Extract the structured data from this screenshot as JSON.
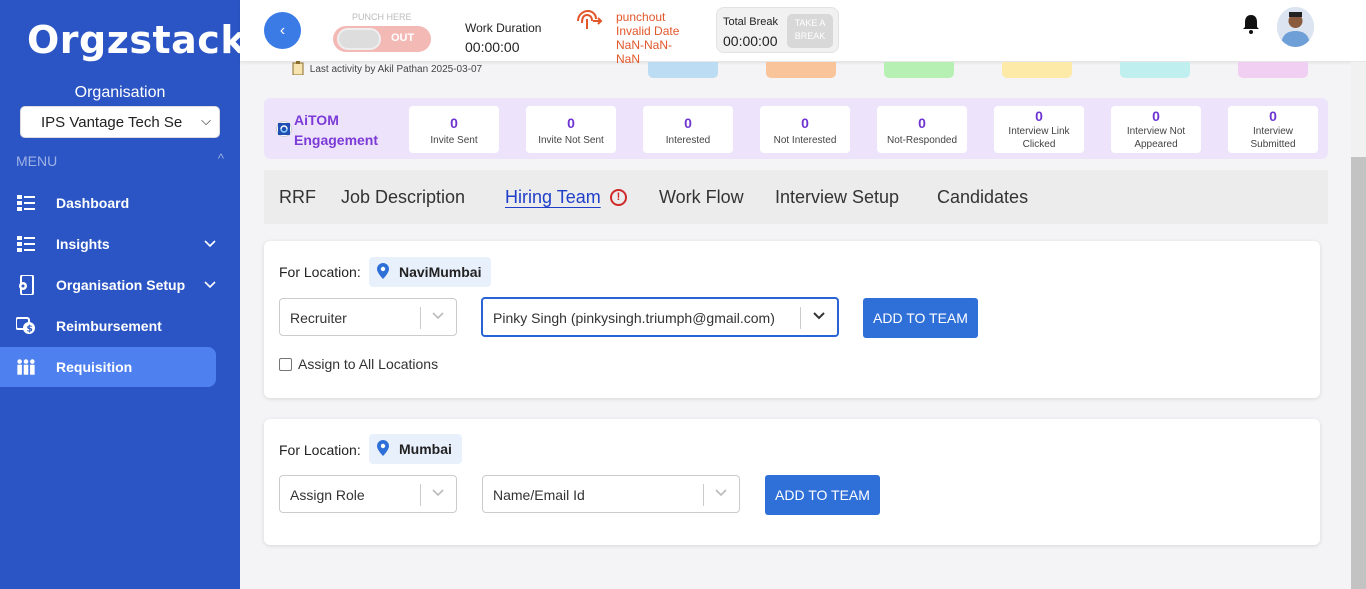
{
  "sidebar": {
    "logo": "Orgzstack",
    "org_label": "Organisation",
    "org_select": "IPS Vantage Tech Se",
    "menu_label": "MENU",
    "items": [
      {
        "label": "Dashboard",
        "icon": "list-icon"
      },
      {
        "label": "Insights",
        "icon": "list-icon"
      },
      {
        "label": "Organisation Setup",
        "icon": "phone-gear-icon"
      },
      {
        "label": "Reimbursement",
        "icon": "reimbursement-icon"
      },
      {
        "label": "Requisition",
        "icon": "people-icon"
      }
    ]
  },
  "header": {
    "punch_label": "PUNCH HERE",
    "punch_toggle_text": "OUT",
    "work_duration_label": "Work Duration",
    "work_duration_value": "00:00:00",
    "punchout_line1": "punchout",
    "punchout_line2": "Invalid Date",
    "punchout_line3": "NaN-NaN-",
    "punchout_line4": "NaN",
    "total_break_label": "Total Break",
    "total_break_value": "00:00:00",
    "take_break_line1": "TAKE A",
    "take_break_line2": "BREAK"
  },
  "activity": "Last activity by Akil Pathan 2025-03-07",
  "stat_colors": [
    "#bcdcf4",
    "#f9c49a",
    "#b6f0b2",
    "#fde9a8",
    "#bff0ef",
    "#f1cff2"
  ],
  "aitom": {
    "title_line1": "AiTOM",
    "title_line2": "Engagement",
    "cards": [
      {
        "value": "0",
        "label1": "Invite Sent",
        "label2": ""
      },
      {
        "value": "0",
        "label1": "Invite Not Sent",
        "label2": ""
      },
      {
        "value": "0",
        "label1": "Interested",
        "label2": ""
      },
      {
        "value": "0",
        "label1": "Not Interested",
        "label2": ""
      },
      {
        "value": "0",
        "label1": "Not-Responded",
        "label2": ""
      },
      {
        "value": "0",
        "label1": "Interview Link",
        "label2": "Clicked"
      },
      {
        "value": "0",
        "label1": "Interview Not",
        "label2": "Appeared"
      },
      {
        "value": "0",
        "label1": "Interview",
        "label2": "Submitted"
      }
    ]
  },
  "tabs": [
    "RRF",
    "Job Description",
    "Hiring Team",
    "Work Flow",
    "Interview Setup",
    "Candidates"
  ],
  "locations": [
    {
      "for_label": "For Location:",
      "name": "NaviMumbai",
      "role": "Recruiter",
      "person": "Pinky Singh (pinkysingh.triumph@gmail.com)",
      "add_button": "ADD TO TEAM",
      "assign_all": "Assign to All Locations"
    },
    {
      "for_label": "For Location:",
      "name": "Mumbai",
      "role": "Assign Role",
      "person": "Name/Email Id",
      "add_button": "ADD TO TEAM"
    }
  ]
}
